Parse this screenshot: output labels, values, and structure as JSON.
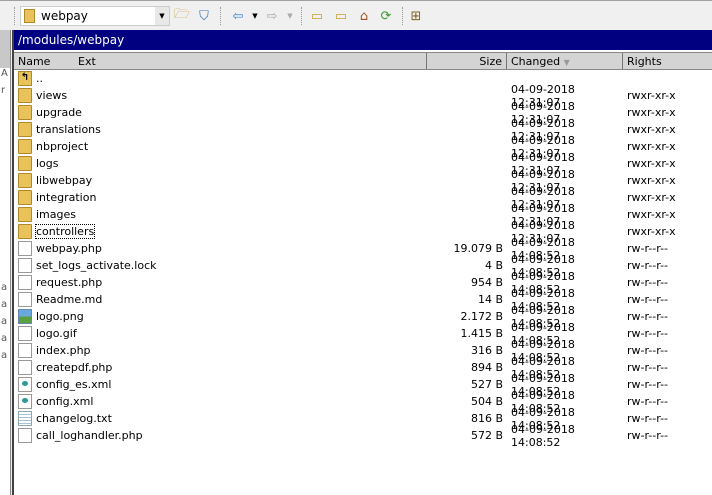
{
  "toolbar": {
    "location": "webpay",
    "buttons": [
      "open-folder",
      "filter",
      "back",
      "back-dropdown",
      "forward",
      "forward-dropdown",
      "parent-directory",
      "root-directory",
      "home-directory",
      "refresh",
      "tree"
    ]
  },
  "path": "/modules/webpay",
  "columns": {
    "name": "Name",
    "ext": "Ext",
    "size": "Size",
    "changed": "Changed",
    "rights": "Rights"
  },
  "left_panel_fragments": [
    "A",
    "r",
    "a",
    "a",
    "a",
    "a",
    "a"
  ],
  "files": [
    {
      "name": "..",
      "type": "up",
      "size": "",
      "changed": "",
      "rights": ""
    },
    {
      "name": "views",
      "type": "folder",
      "size": "",
      "changed": "04-09-2018 12:31:07",
      "rights": "rwxr-xr-x"
    },
    {
      "name": "upgrade",
      "type": "folder",
      "size": "",
      "changed": "04-09-2018 12:31:07",
      "rights": "rwxr-xr-x"
    },
    {
      "name": "translations",
      "type": "folder",
      "size": "",
      "changed": "04-09-2018 12:31:07",
      "rights": "rwxr-xr-x"
    },
    {
      "name": "nbproject",
      "type": "folder",
      "size": "",
      "changed": "04-09-2018 12:31:07",
      "rights": "rwxr-xr-x"
    },
    {
      "name": "logs",
      "type": "folder",
      "size": "",
      "changed": "04-09-2018 12:31:07",
      "rights": "rwxr-xr-x"
    },
    {
      "name": "libwebpay",
      "type": "folder",
      "size": "",
      "changed": "04-09-2018 12:31:07",
      "rights": "rwxr-xr-x"
    },
    {
      "name": "integration",
      "type": "folder",
      "size": "",
      "changed": "04-09-2018 12:31:07",
      "rights": "rwxr-xr-x"
    },
    {
      "name": "images",
      "type": "folder",
      "size": "",
      "changed": "04-09-2018 12:31:07",
      "rights": "rwxr-xr-x"
    },
    {
      "name": "controllers",
      "type": "folder",
      "size": "",
      "changed": "04-09-2018 12:31:07",
      "rights": "rwxr-xr-x",
      "focused": true
    },
    {
      "name": "webpay.php",
      "type": "file",
      "size": "19.079 B",
      "changed": "04-09-2018 14:08:52",
      "rights": "rw-r--r--"
    },
    {
      "name": "set_logs_activate.lock",
      "type": "file",
      "size": "4 B",
      "changed": "04-09-2018 14:08:52",
      "rights": "rw-r--r--"
    },
    {
      "name": "request.php",
      "type": "file",
      "size": "954 B",
      "changed": "04-09-2018 14:08:52",
      "rights": "rw-r--r--"
    },
    {
      "name": "Readme.md",
      "type": "file",
      "size": "14 B",
      "changed": "04-09-2018 14:08:52",
      "rights": "rw-r--r--"
    },
    {
      "name": "logo.png",
      "type": "image",
      "size": "2.172 B",
      "changed": "04-09-2018 14:08:52",
      "rights": "rw-r--r--"
    },
    {
      "name": "logo.gif",
      "type": "file",
      "size": "1.415 B",
      "changed": "04-09-2018 14:08:52",
      "rights": "rw-r--r--"
    },
    {
      "name": "index.php",
      "type": "file",
      "size": "316 B",
      "changed": "04-09-2018 14:08:52",
      "rights": "rw-r--r--"
    },
    {
      "name": "createpdf.php",
      "type": "file",
      "size": "894 B",
      "changed": "04-09-2018 14:08:52",
      "rights": "rw-r--r--"
    },
    {
      "name": "config_es.xml",
      "type": "xml",
      "size": "527 B",
      "changed": "04-09-2018 14:08:52",
      "rights": "rw-r--r--"
    },
    {
      "name": "config.xml",
      "type": "xml",
      "size": "504 B",
      "changed": "04-09-2018 14:08:52",
      "rights": "rw-r--r--"
    },
    {
      "name": "changelog.txt",
      "type": "text",
      "size": "816 B",
      "changed": "04-09-2018 14:08:52",
      "rights": "rw-r--r--"
    },
    {
      "name": "call_loghandler.php",
      "type": "file",
      "size": "572 B",
      "changed": "04-09-2018 14:08:52",
      "rights": "rw-r--r--"
    }
  ]
}
